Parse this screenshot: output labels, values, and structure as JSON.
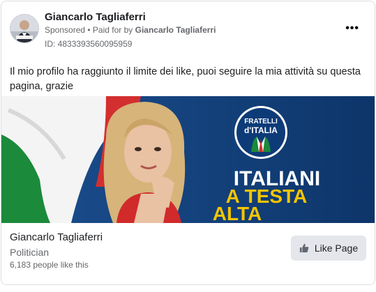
{
  "post": {
    "author_name": "Giancarlo Tagliaferri",
    "sponsored_label": "Sponsored",
    "separator": " • ",
    "paid_for_by_prefix": "Paid for by ",
    "paid_for_by_name": "Giancarlo Tagliaferri",
    "ad_id": "ID: 4833393560095959",
    "more_icon": "more-dots-icon",
    "body_text": "Il mio profilo ha raggiunto il limite dei like, puoi seguire la mia attività su questa pagina, grazie"
  },
  "creative": {
    "logo_line1": "FRATELLI",
    "logo_line2": "d'ITALIA",
    "headline_line1": "ITALIANI",
    "headline_line2": "A TESTA",
    "headline_line3": "ALTA",
    "colors": {
      "background_blue": "#0f3f7a",
      "headline_white": "#ffffff",
      "headline_yellow": "#f5c400",
      "flag_green": "#1b8a3a",
      "flag_red": "#d32f2f"
    }
  },
  "footer": {
    "page_name": "Giancarlo Tagliaferri",
    "category": "Politician",
    "likes": "6,183 people like this",
    "like_button_label": "Like Page",
    "like_button_icon": "thumbs-up-icon"
  }
}
